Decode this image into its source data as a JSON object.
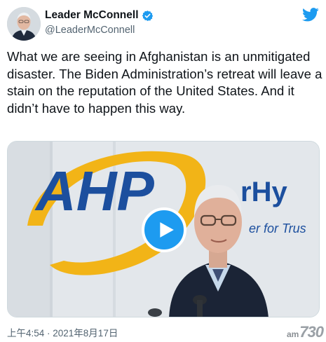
{
  "author": {
    "display_name": "Leader McConnell",
    "handle": "@LeaderMcConnell",
    "verified": true,
    "avatar_icon": "profile-photo"
  },
  "brand_icon": "twitter-bird-icon",
  "brand_color": "#1d9bf0",
  "tweet": {
    "text": "What we are seeing in Afghanistan is an unmitigated disaster. The Biden Administration’s retreat will leave a stain on the reputation of the United States. And it didn’t have to happen this way."
  },
  "media": {
    "type": "video",
    "backdrop_logo": "AHP",
    "backdrop_partial_text": "rHy",
    "backdrop_tagline": "er for Trus",
    "play_icon": "play-icon"
  },
  "timestamp": "上午4:54 · 2021年8月17日",
  "watermark": {
    "small": "am",
    "big": "730"
  }
}
